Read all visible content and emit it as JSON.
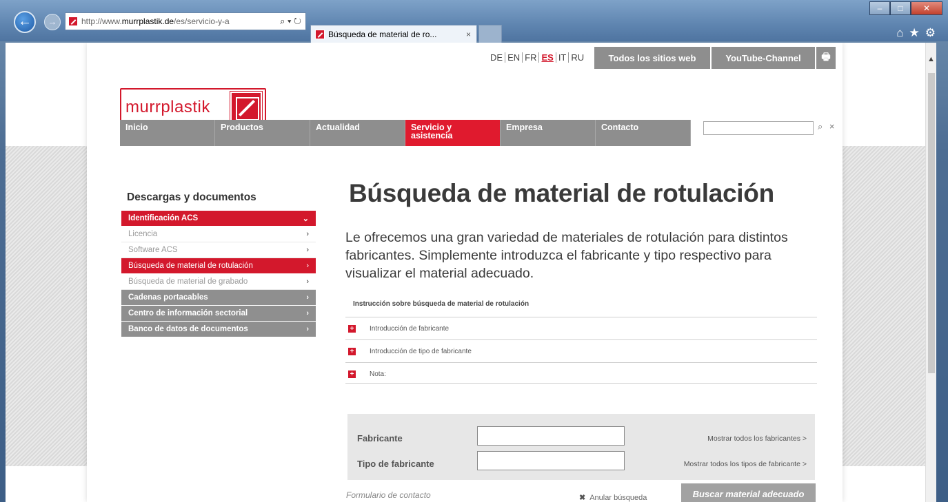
{
  "browser": {
    "address_prefix": "http://www.",
    "address_domain": "murrplastik.de",
    "address_path": "/es/servicio-y-a",
    "address_icons": "⌕ ▾ ↻",
    "tab_title": "Búsqueda de material de ro...",
    "tab_close": "×",
    "back_icon": "←",
    "forward_icon": "→",
    "right_icons": "⌂★⚙",
    "win_min": "–",
    "win_max": "□",
    "win_close": "✕"
  },
  "header": {
    "languages": [
      "DE",
      "EN",
      "FR",
      "ES",
      "IT",
      "RU"
    ],
    "active_language": "ES",
    "all_sites": "Todos los sitios web",
    "youtube": "YouTube-Channel",
    "print_icon": "🖶",
    "logo_text": "murrplastik"
  },
  "nav": {
    "items": [
      "Inicio",
      "Productos",
      "Actualidad",
      "Servicio y asistencia",
      "Empresa",
      "Contacto"
    ],
    "active": "Servicio y asistencia",
    "search_icon": "⌕",
    "clear_icon": "×"
  },
  "sidebar": {
    "heading": "Descargas y documentos",
    "items": [
      {
        "label": "Identificación ACS",
        "chevron": "⌄"
      },
      {
        "label": "Licencia",
        "chevron": "›"
      },
      {
        "label": "Software ACS",
        "chevron": "›"
      },
      {
        "label": "Búsqueda de material de rotulación",
        "chevron": "›"
      },
      {
        "label": "Búsqueda de material de grabado",
        "chevron": "›"
      },
      {
        "label": "Cadenas portacables",
        "chevron": "›"
      },
      {
        "label": "Centro de información sectorial",
        "chevron": "›"
      },
      {
        "label": "Banco de datos de documentos",
        "chevron": "›"
      }
    ]
  },
  "main": {
    "title": "Búsqueda de material de rotulación",
    "intro": "Le ofrecemos una gran variedad de materiales de rotulación para distintos fabricantes. Simplemente introduzca el fabricante y tipo respectivo para visualizar el material adecuado.",
    "instructions_heading": "Instrucción sobre búsqueda de material de rotulación",
    "accordion": [
      "Introducción de fabricante",
      "Introducción de tipo de fabricante",
      "Nota:"
    ],
    "plus_icon": "+"
  },
  "form": {
    "manufacturer_label": "Fabricante",
    "type_label": "Tipo de fabricante",
    "show_all_manufacturers": "Mostrar todos los fabricantes  >",
    "show_all_types": "Mostrar todos los tipos de fabricante  >",
    "contact_form": "Formulario de contacto",
    "cancel_icon": "✖",
    "cancel_search": "Anular búsqueda",
    "submit": "Buscar material adecuado"
  }
}
